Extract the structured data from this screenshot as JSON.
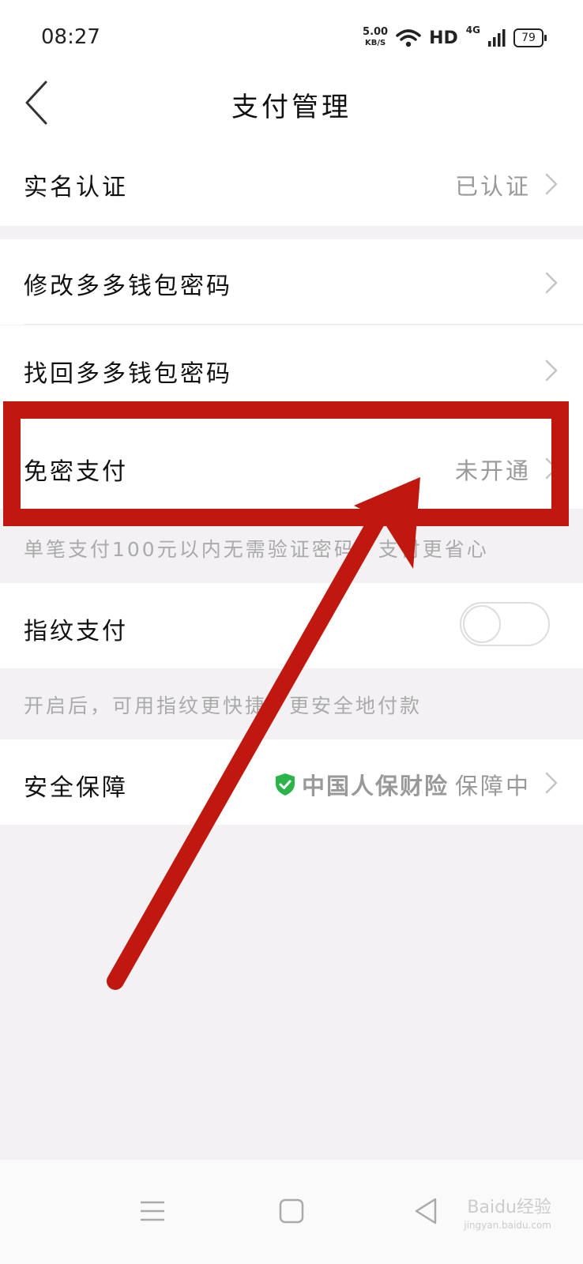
{
  "status_bar": {
    "time": "08:27",
    "net_speed_value": "5.00",
    "net_speed_unit": "KB/S",
    "hd_label": "HD",
    "network_label": "4G",
    "battery": "79"
  },
  "header": {
    "title": "支付管理"
  },
  "rows": {
    "real_name": {
      "label": "实名认证",
      "value": "已认证"
    },
    "change_password": {
      "label": "修改多多钱包密码"
    },
    "recover_password": {
      "label": "找回多多钱包密码"
    },
    "password_free": {
      "label": "免密支付",
      "value": "未开通"
    },
    "password_free_hint": "单笔支付100元以内无需验证密码，支付更省心",
    "fingerprint": {
      "label": "指纹支付",
      "toggle_on": false
    },
    "fingerprint_hint": "开启后，可用指纹更快捷、更安全地付款",
    "security": {
      "label": "安全保障",
      "insurer": "中国人保财险",
      "status": "保障中"
    }
  },
  "colors": {
    "annotation_red": "#c0170e",
    "shield_green": "#2bb44a",
    "secondary_text": "#999999"
  },
  "watermark": {
    "text": "Baidu经验",
    "sub": "jingyan.baidu.com"
  }
}
